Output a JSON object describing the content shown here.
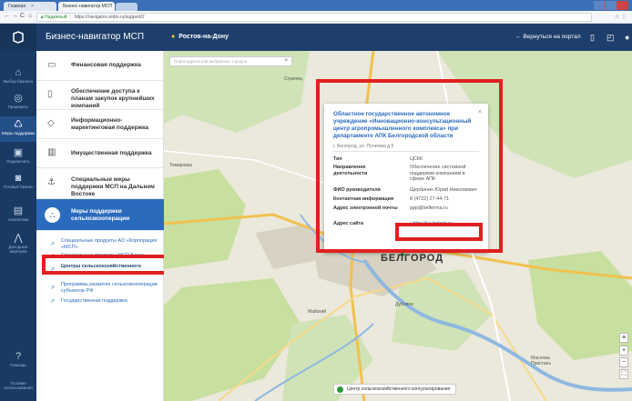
{
  "browser": {
    "tabs": [
      {
        "label": "Главная"
      },
      {
        "label": "Бизнес-навигатор МСП"
      }
    ],
    "url_secure": "Надежный",
    "url": "https://navigator.smbn.ru/support/2"
  },
  "header": {
    "title": "Бизнес-навигатор МСП",
    "region": "Ростов-на-Дону",
    "back_label": "Вернуться на портал"
  },
  "rail": [
    {
      "label": "Выбор бизнеса"
    },
    {
      "label": "Проверить"
    },
    {
      "label": "Меры поддержки"
    },
    {
      "label": "Подключить"
    },
    {
      "label": "Готовый бизнес"
    },
    {
      "label": "Аналитика"
    },
    {
      "label": "Доходные перегрев"
    },
    {
      "label": "Помощь"
    },
    {
      "label": "Условия использования"
    }
  ],
  "menu": {
    "items": [
      {
        "label": "Финансовая поддержка"
      },
      {
        "label": "Обеспечение доступа к планам закупок крупнейших компаний"
      },
      {
        "label": "Информационно-маркетинговая поддержка"
      },
      {
        "label": "Имущественная поддержка"
      },
      {
        "label": "Специальные меры поддержки МСП на Дальнем Востоке"
      },
      {
        "label": "Меры поддержки сельхозкооперации"
      }
    ],
    "sub": [
      {
        "label": "Специальные продукты АО «Корпорация «МСП»"
      },
      {
        "label": "Специальные продукты МСП Банка"
      },
      {
        "label": "Центры сельскохозяйственного консультирования"
      },
      {
        "label": "Программы развития сельхозкооперации субъектов РФ"
      },
      {
        "label": "Государственная поддержка"
      }
    ]
  },
  "map": {
    "search_placeholder": "Поиск адреса или выбранных городов",
    "city": "БЕЛГОРОД",
    "labels": [
      "Стрелец",
      "Томаровка",
      "Майский",
      "Дубовое",
      "Маслова Пристань"
    ],
    "legend": "Центр сельскохозяйственного консультирования"
  },
  "popup": {
    "title": "Областное государственное автономное учреждение «Инновационно-консультационный центр агропромышленного комплекса» при департаменте АПК Белгородской области",
    "address": "г. Белгород, ул. Пугачева д.5",
    "rows": [
      {
        "key": "Тип",
        "value": "ЦСКК"
      },
      {
        "key": "Направление деятельности",
        "value": "Обеспечение системной поддержки компаниям в сфере АПК"
      },
      {
        "key": "ФИО руководителя",
        "value": "Щербинин Юрий Николаевич"
      },
      {
        "key": "Контактная информация",
        "value": "8 (4722) 27-44-71"
      },
      {
        "key": "Адрес электронной почты",
        "value": "ppp@belferma.ru"
      },
      {
        "key": "Адрес сайта",
        "value": "http://ikc.belapk.ru"
      }
    ]
  },
  "colors": {
    "header": "#1e3f6b",
    "rail": "#183a63",
    "accent": "#2a6bbd",
    "highlight": "#e02020"
  }
}
